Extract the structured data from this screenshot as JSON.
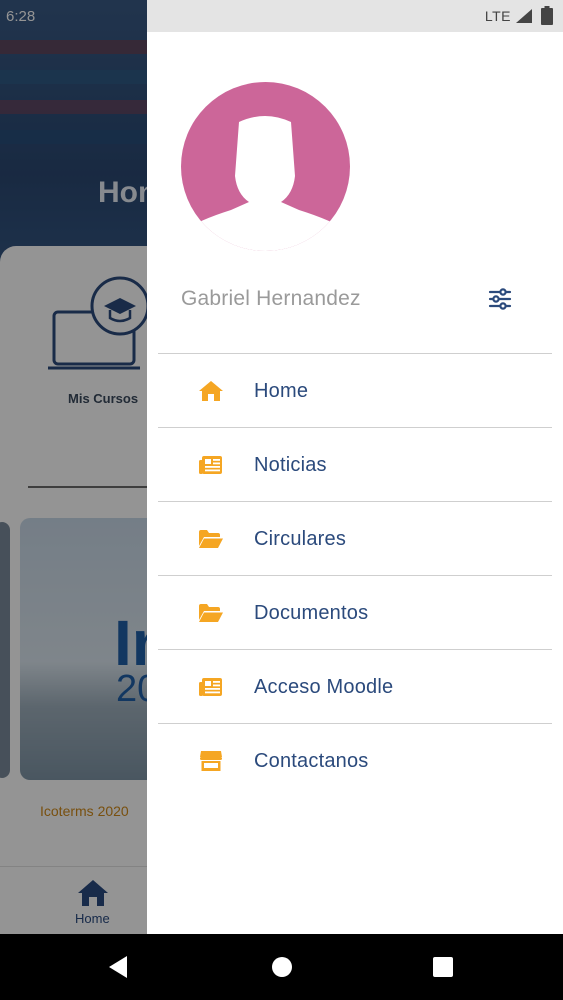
{
  "background": {
    "status_time": "6:28",
    "hero_title": "Hom",
    "course_label": "Mis Cursos",
    "thumbnail_text_large": "In",
    "thumbnail_text_small": "20",
    "thumbnail_caption": "Icoterms 2020",
    "bottom_nav_home_label": "Home"
  },
  "statusbar": {
    "network": "LTE"
  },
  "drawer": {
    "user_name": "Gabriel Hernandez",
    "menu": [
      {
        "label": "Home",
        "icon": "home-icon"
      },
      {
        "label": "Noticias",
        "icon": "newspaper-icon"
      },
      {
        "label": "Circulares",
        "icon": "folder-open-icon"
      },
      {
        "label": "Documentos",
        "icon": "folder-open-icon"
      },
      {
        "label": "Acceso Moodle",
        "icon": "newspaper-icon"
      },
      {
        "label": "Contactanos",
        "icon": "store-icon"
      }
    ]
  },
  "colors": {
    "icon_accent": "#f5a623",
    "menu_text": "#2b4a7c",
    "avatar_bg": "#cc6699",
    "username_text": "#9a9a9a"
  }
}
